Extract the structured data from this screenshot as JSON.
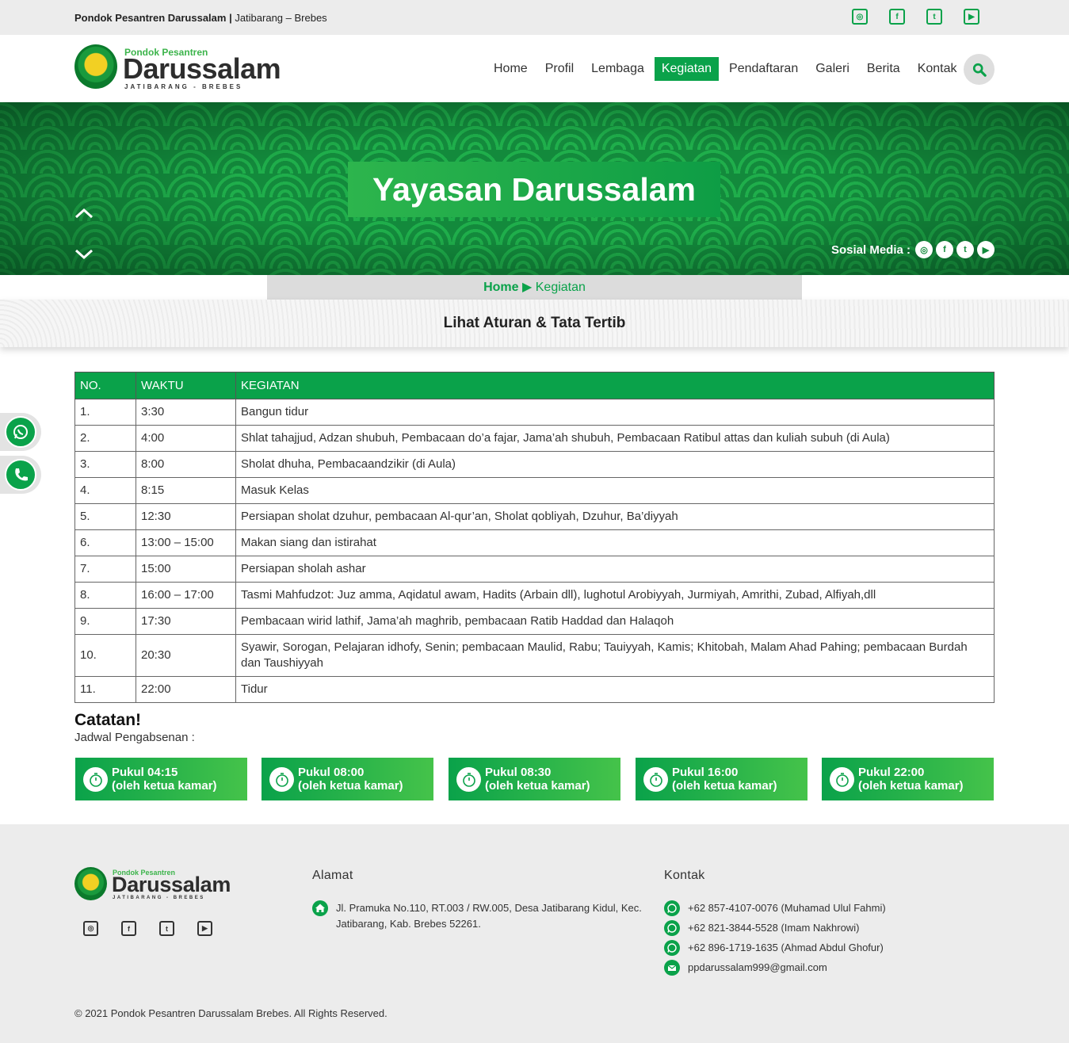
{
  "topbar": {
    "site_name": "Pondok Pesantren Darussalam |",
    "location": " Jatibarang – Brebes",
    "socials": [
      "instagram-icon",
      "facebook-icon",
      "twitter-icon",
      "youtube-icon"
    ]
  },
  "brand": {
    "small": "Pondok Pesantren",
    "big": "Darussalam",
    "sub": "JATIBARANG - BREBES"
  },
  "nav": {
    "items": [
      "Home",
      "Profil",
      "Lembaga",
      "Kegiatan",
      "Pendaftaran",
      "Galeri",
      "Berita",
      "Kontak"
    ],
    "active": "Kegiatan"
  },
  "banner": {
    "title": "Yayasan Darussalam",
    "social_label": "Sosial Media :"
  },
  "breadcrumb": {
    "home": "Home",
    "separator": "▶",
    "current": "Kegiatan"
  },
  "section_title": "Lihat Aturan & Tata Tertib",
  "schedule": {
    "headers": [
      "NO.",
      "WAKTU",
      "KEGIATAN"
    ],
    "rows": [
      {
        "no": "1.",
        "time": "3:30",
        "activity": "Bangun tidur"
      },
      {
        "no": "2.",
        "time": "4:00",
        "activity": "Shlat tahajjud, Adzan shubuh, Pembacaan do’a fajar, Jama’ah shubuh, Pembacaan Ratibul attas dan kuliah subuh (di Aula)"
      },
      {
        "no": "3.",
        "time": "8:00",
        "activity": "Sholat dhuha, Pembacaandzikir (di Aula)"
      },
      {
        "no": "4.",
        "time": "8:15",
        "activity": "Masuk Kelas"
      },
      {
        "no": "5.",
        "time": "12:30",
        "activity": "Persiapan sholat dzuhur, pembacaan Al-qur’an, Sholat qobliyah, Dzuhur, Ba’diyyah"
      },
      {
        "no": "6.",
        "time": "13:00 – 15:00",
        "activity": "Makan siang dan istirahat"
      },
      {
        "no": "7.",
        "time": "15:00",
        "activity": "Persiapan sholah ashar"
      },
      {
        "no": "8.",
        "time": "16:00 – 17:00",
        "activity": "Tasmi  Mahfudzot:  Juz  amma,  Aqidatul  awam,  Hadits (Arbain  dll),  lughotul  Arobiyyah,  Jurmiyah,  Amrithi, Zubad, Alfiyah,dll"
      },
      {
        "no": "9.",
        "time": "17:30",
        "activity": "Pembacaan wirid lathif, Jama’ah maghrib, pembacaan Ratib Haddad dan Halaqoh"
      },
      {
        "no": "10.",
        "time": "20:30",
        "activity": "Syawir,  Sorogan,  Pelajaran  idhofy,  Senin;  pembacaan Maulid, Rabu; Tauiyyah, Kamis; Khitobah, Malam Ahad Pahing; pembacaan Burdah dan Taushiyyah"
      },
      {
        "no": "11.",
        "time": "22:00",
        "activity": "Tidur"
      }
    ]
  },
  "catatan": {
    "title": "Catatan!",
    "subtitle": "Jadwal Pengabsenan :",
    "cards": [
      {
        "time": "Pukul 04:15",
        "note": "(oleh ketua kamar)"
      },
      {
        "time": "Pukul 08:00",
        "note": "(oleh ketua kamar)"
      },
      {
        "time": "Pukul 08:30",
        "note": "(oleh ketua kamar)"
      },
      {
        "time": "Pukul 16:00",
        "note": "(oleh ketua kamar)"
      },
      {
        "time": "Pukul 22:00",
        "note": "(oleh ketua kamar)"
      }
    ]
  },
  "footer": {
    "alamat_title": "Alamat",
    "alamat": "Jl. Pramuka No.110, RT.003 / RW.005, Desa Jatibarang Kidul, Kec. Jatibarang, Kab. Brebes 52261.",
    "kontak_title": "Kontak",
    "contacts": [
      {
        "icon": "whatsapp-icon",
        "text": "+62 857-4107-0076 (Muhamad Ulul Fahmi)"
      },
      {
        "icon": "whatsapp-icon",
        "text": "+62 821-3844-5528 (Imam Nakhrowi)"
      },
      {
        "icon": "whatsapp-icon",
        "text": "+62 896-1719-1635 (Ahmad Abdul Ghofur)"
      },
      {
        "icon": "mail-icon",
        "text": "ppdarussalam999@gmail.com"
      }
    ],
    "copyright": "© 2021 Pondok Pesantren Darussalam Brebes. All Rights Reserved."
  },
  "colors": {
    "primary": "#0aa24a",
    "footer_bg": "#ececec"
  }
}
